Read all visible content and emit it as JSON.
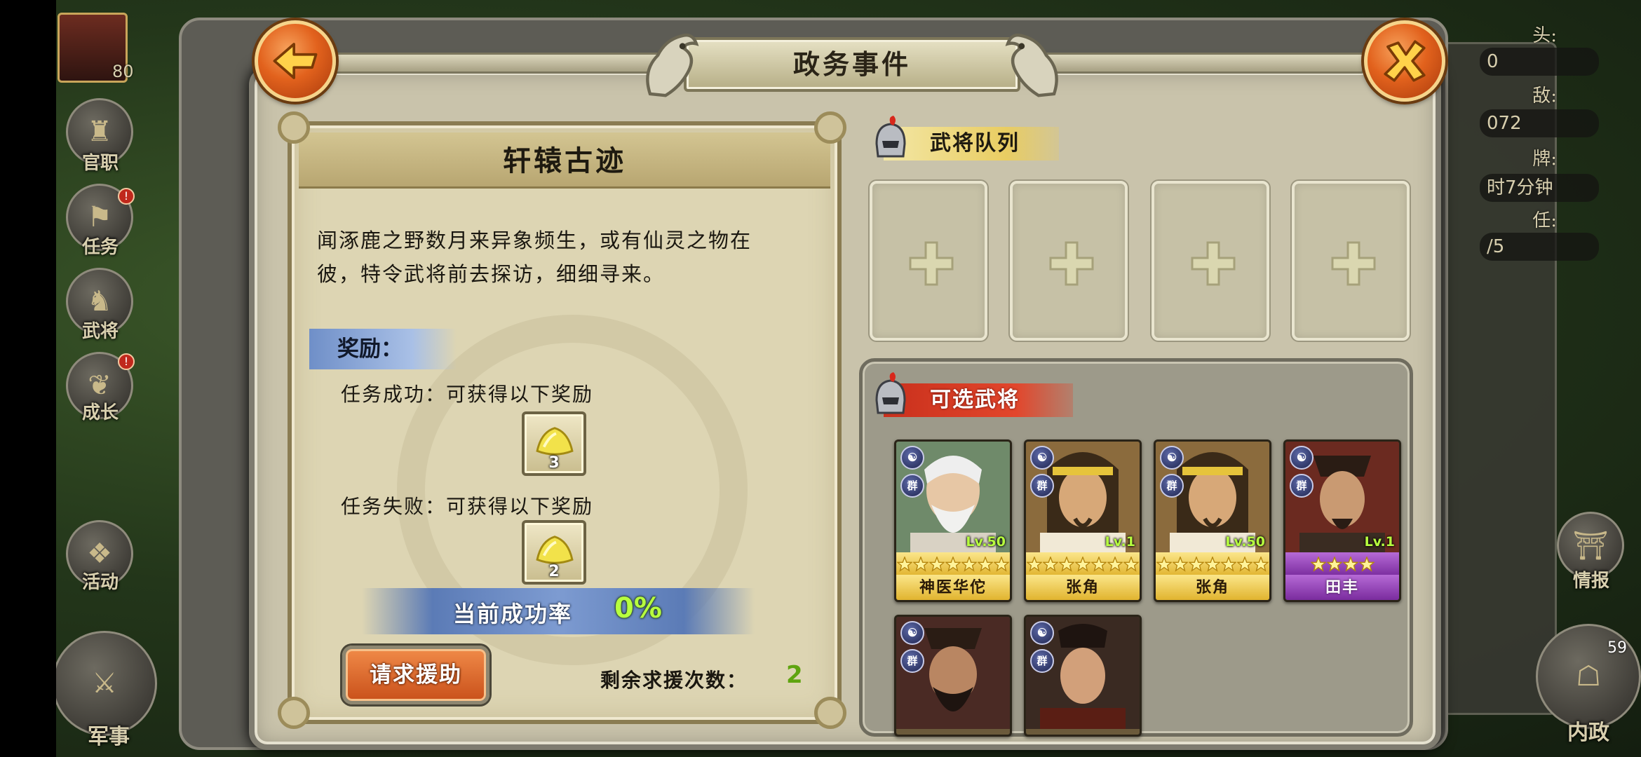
{
  "dialog": {
    "title": "政务事件",
    "back_icon": "arrow-left-icon",
    "close_icon": "close-x-icon"
  },
  "event": {
    "title": "轩辕古迹",
    "description_lines": [
      "闻涿鹿之野数月来异象频生，或有仙灵之物在",
      "彼，特令武将前去探访，细细寻来。"
    ],
    "reward_header": "奖励：",
    "success_text": "任务成功：可获得以下奖励",
    "success_reward_qty": "3",
    "failure_text": "任务失败：可获得以下奖励",
    "failure_reward_qty": "2",
    "success_rate_label": "当前成功率",
    "success_rate_value": "0%",
    "help_button_label": "请求援助",
    "remaining_label": "剩余求援次数：",
    "remaining_value": "2"
  },
  "queue": {
    "header": "武将队列",
    "slots": [
      "+",
      "+",
      "+",
      "+"
    ]
  },
  "available": {
    "header": "可选武将",
    "generals": [
      {
        "name": "神医华佗",
        "level": "Lv.50",
        "stars": 7,
        "rarity": "gold",
        "faction": "群"
      },
      {
        "name": "张角",
        "level": "Lv.1",
        "stars": 7,
        "rarity": "gold",
        "faction": "群"
      },
      {
        "name": "张角",
        "level": "Lv.50",
        "stars": 7,
        "rarity": "gold",
        "faction": "群"
      },
      {
        "name": "田丰",
        "level": "Lv.1",
        "stars": 4,
        "rarity": "purple",
        "faction": "群"
      },
      {
        "name": "",
        "level": "",
        "stars": 0,
        "rarity": "partial",
        "faction": "群"
      },
      {
        "name": "",
        "level": "",
        "stars": 0,
        "rarity": "partial",
        "faction": "群"
      }
    ]
  },
  "background": {
    "left_menu": [
      "官职",
      "任务",
      "武将",
      "成长",
      "活动",
      "军事"
    ],
    "right_menu": [
      "情报",
      "内政"
    ],
    "level_badge": "80",
    "right_badge": "59",
    "right_stats": [
      "0",
      "072",
      "时7分钟",
      "/5"
    ],
    "right_labels": [
      "头:",
      "敌:",
      "牌:",
      "任:"
    ]
  },
  "colors": {
    "accent_orange": "#e2621d",
    "success_green": "#b7ff3f",
    "rate_blue": "#7d9bd1",
    "card_gold": "#e1b42f",
    "card_purple": "#7a2c9e"
  }
}
